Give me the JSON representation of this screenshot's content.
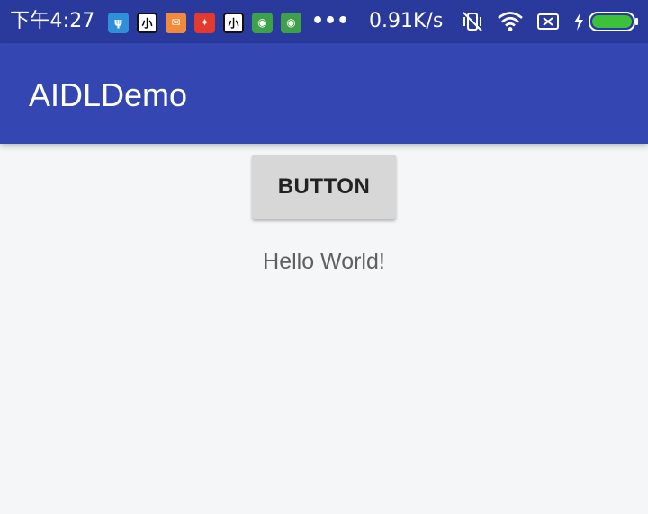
{
  "status_bar": {
    "time": "下午4:27",
    "network_speed": "0.91K/s",
    "notification_icons": [
      {
        "name": "pin-app-icon",
        "glyph": "ψ"
      },
      {
        "name": "comic-app-icon",
        "glyph": "小"
      },
      {
        "name": "mail-app-icon",
        "glyph": "✉"
      },
      {
        "name": "game-app-icon",
        "glyph": "✦"
      },
      {
        "name": "comic-app-icon",
        "glyph": "小"
      },
      {
        "name": "android-app-icon",
        "glyph": "◉"
      },
      {
        "name": "android-app-icon",
        "glyph": "◉"
      }
    ],
    "overflow_indicator": "•••",
    "system_icons": [
      "vibrate-silent-icon",
      "wifi-icon",
      "no-sim-icon",
      "charging-icon",
      "battery-icon"
    ]
  },
  "app_bar": {
    "title": "AIDLDemo"
  },
  "content": {
    "button_label": "BUTTON",
    "hello_text": "Hello World!"
  },
  "colors": {
    "status_bar": "#2a3a9c",
    "app_bar": "#3446b2",
    "background": "#f5f6f8",
    "button": "#d7d7d7",
    "battery": "#3cc13b"
  }
}
